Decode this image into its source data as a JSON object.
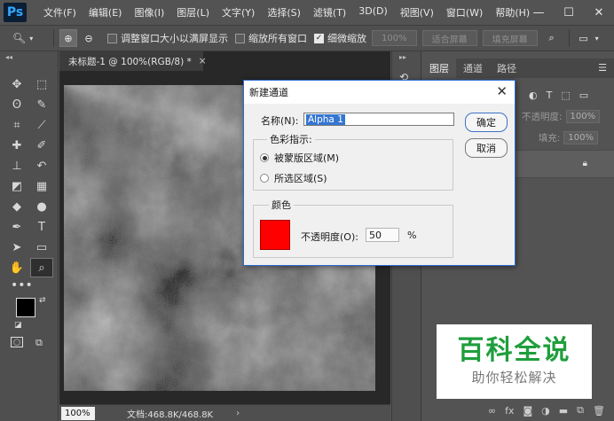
{
  "app": {
    "logo": "Ps"
  },
  "menu": [
    "文件(F)",
    "编辑(E)",
    "图像(I)",
    "图层(L)",
    "文字(Y)",
    "选择(S)",
    "滤镜(T)",
    "3D(D)",
    "视图(V)",
    "窗口(W)",
    "帮助(H)"
  ],
  "window_controls": {
    "minimize": "—",
    "maximize": "☐",
    "close": "✕"
  },
  "options": {
    "resize_windows": "调整窗口大小以满屏显示",
    "zoom_all": "缩放所有窗口",
    "scrubby_zoom": "细微缩放",
    "zoom_100": "100%",
    "fit_screen": "适合屏幕",
    "fill_screen": "填充屏幕",
    "resize_checked": false,
    "zoom_all_checked": false,
    "scrubby_checked": true
  },
  "document": {
    "tab_title": "未标题-1 @ 100%(RGB/8) *",
    "tab_close": "×",
    "zoom": "100%",
    "info": "文档:468.8K/468.8K",
    "arrow": "›"
  },
  "panel": {
    "tabs": [
      "图层",
      "通道",
      "路径"
    ],
    "active_tab": 0,
    "opacity_label": "不透明度:",
    "opacity_value": "100%",
    "fill_label": "填充:",
    "fill_value": "100%"
  },
  "dialog": {
    "title": "新建通道",
    "close": "✕",
    "name_label": "名称(N):",
    "name_value": "Alpha 1",
    "color_indicates_label": "色彩指示:",
    "radio_masked": "被蒙版区域(M)",
    "radio_selected": "所选区域(S)",
    "selected_radio": "masked",
    "color_group_label": "颜色",
    "opacity_label": "不透明度(O):",
    "opacity_value": "50",
    "percent": "%",
    "ok": "确定",
    "cancel": "取消",
    "swatch_color": "#ff0000"
  },
  "watermark": {
    "line1": "百科全说",
    "line2": "助你轻松解决"
  }
}
